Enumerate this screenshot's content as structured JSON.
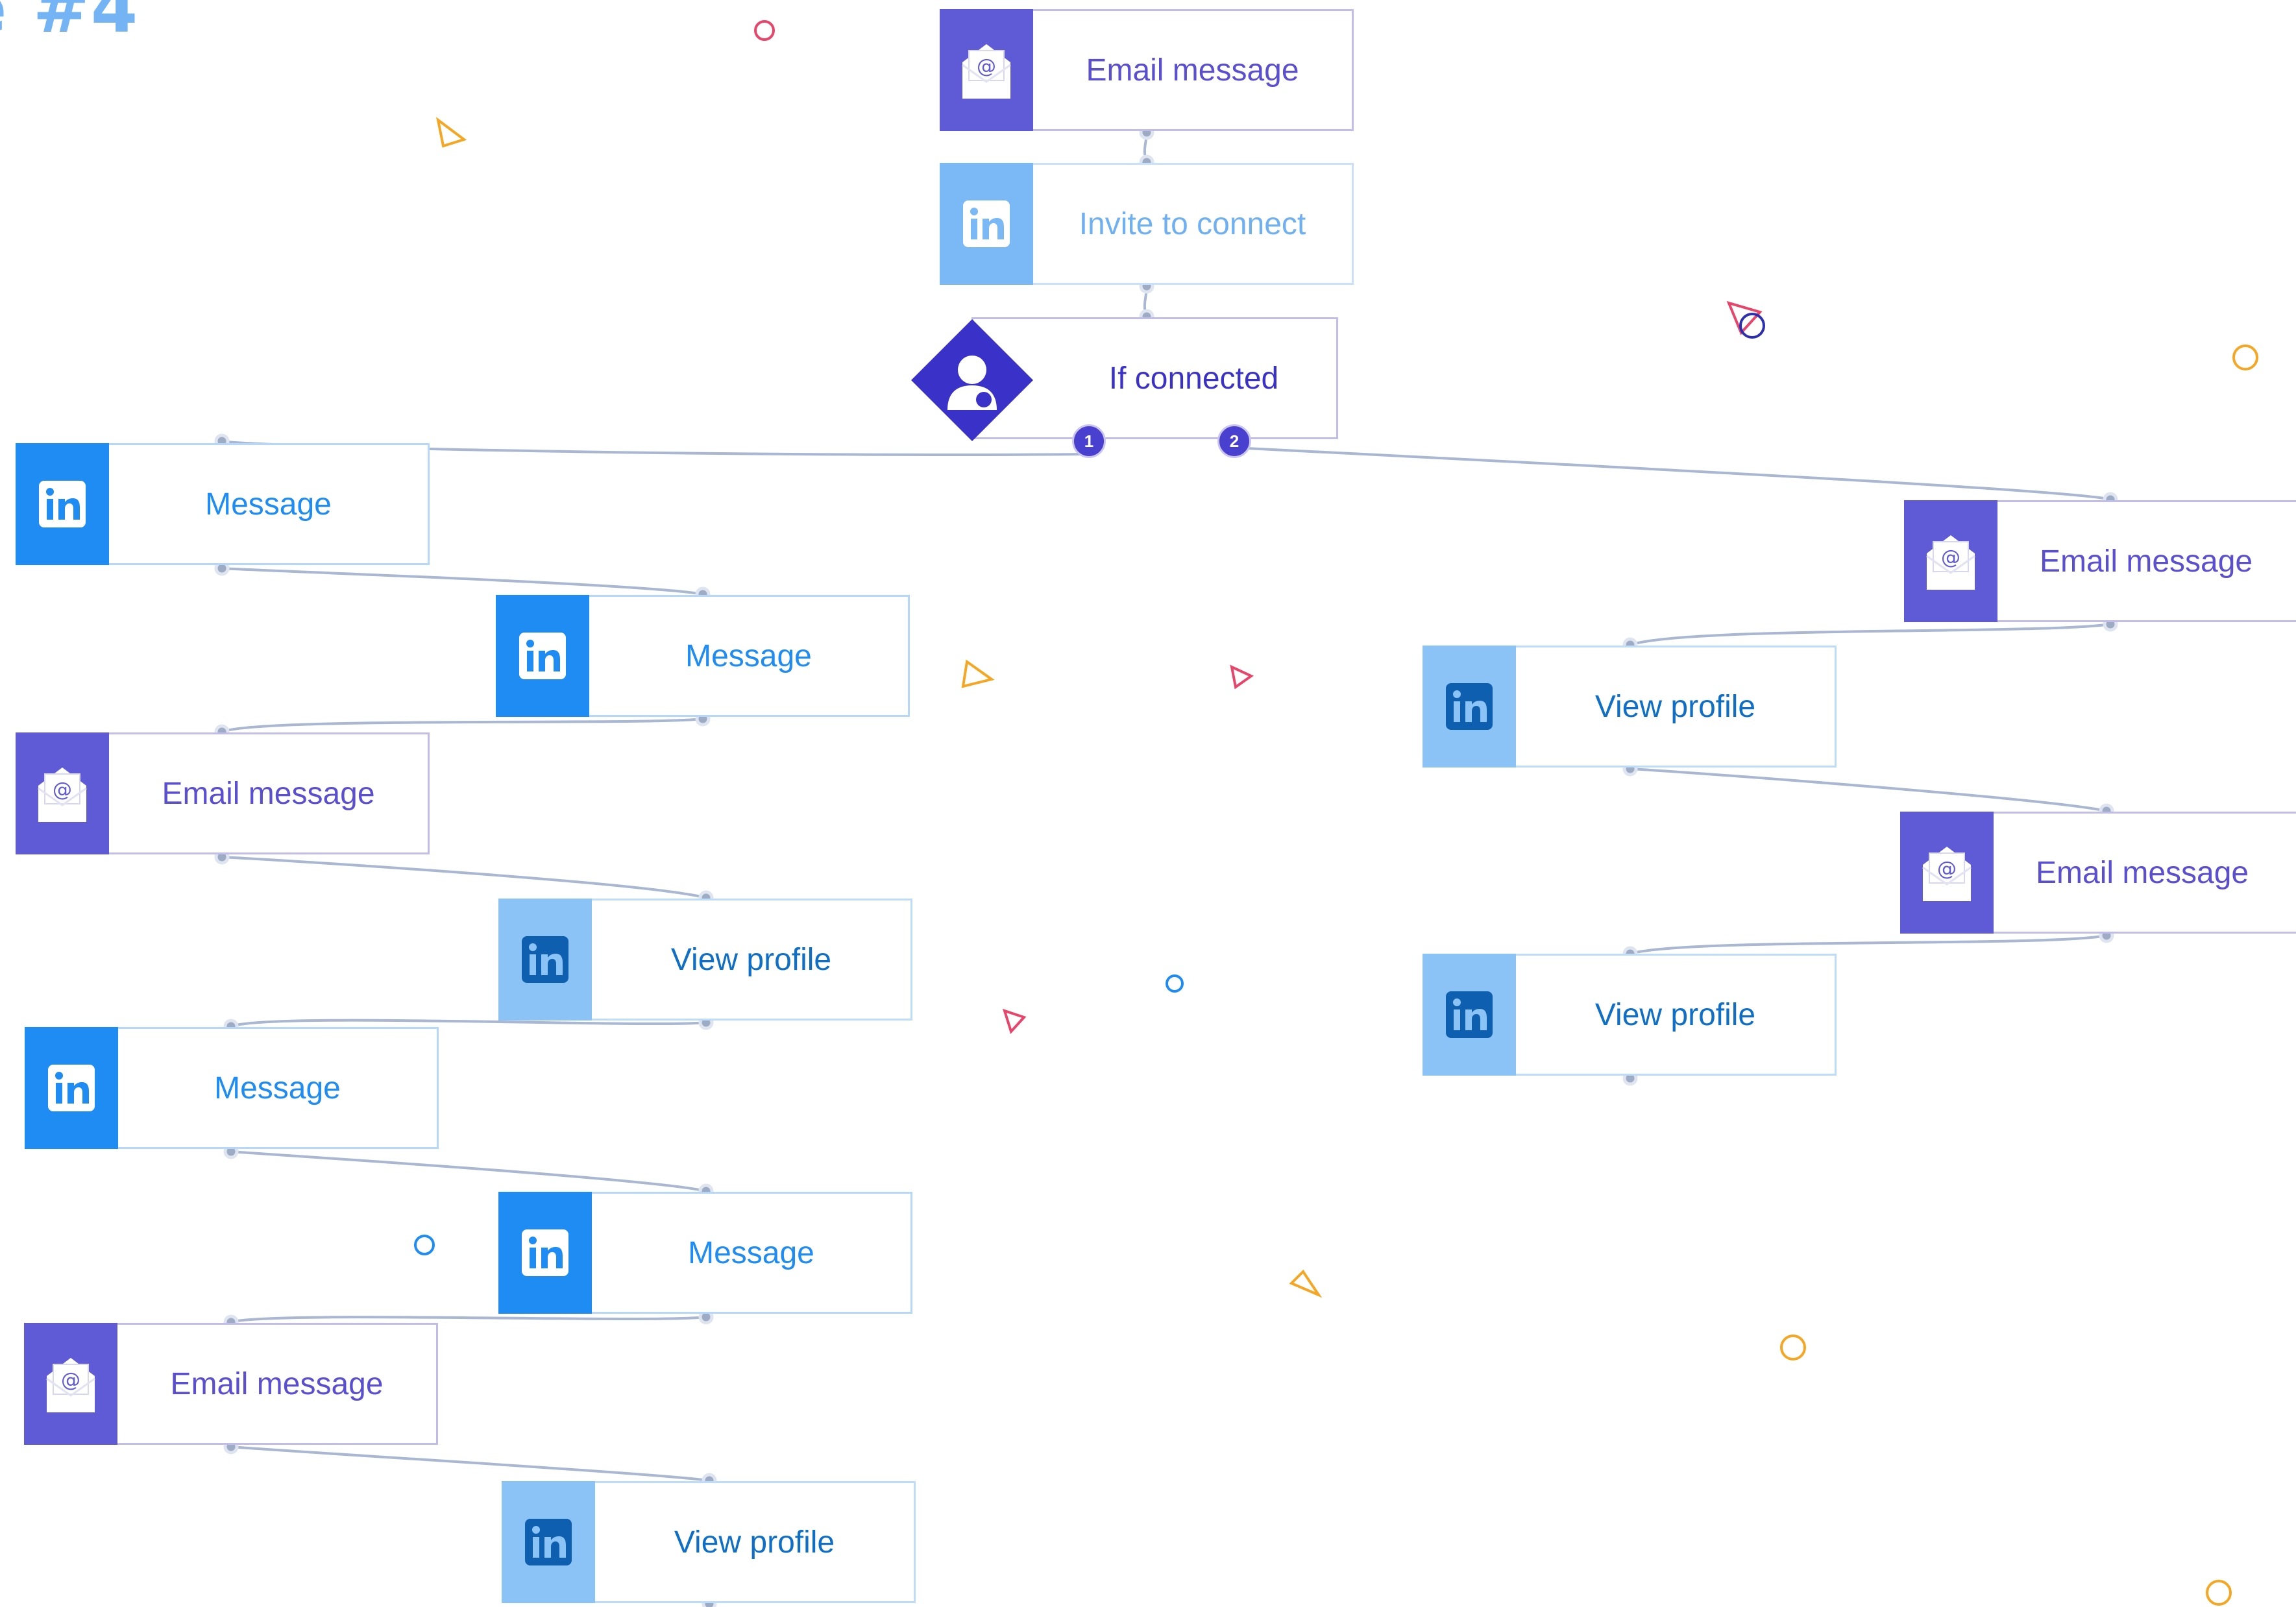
{
  "heading": "e #4",
  "colors": {
    "email_tile": "#5f5bd6",
    "linkedin_message_tile": "#1e8cf2",
    "linkedin_view_tile": "#8cc3f7",
    "linkedin_invite_tile": "#7ab8f6",
    "condition_diamond": "#3a31c9",
    "connector": "#a9b7d3"
  },
  "nodes": {
    "top_email": {
      "label": "Email message",
      "icon": "email-icon"
    },
    "invite": {
      "label": "Invite to connect",
      "icon": "linkedin-icon"
    },
    "condition": {
      "label": "If connected",
      "icon": "connected-user-icon",
      "branches": [
        "1",
        "2"
      ]
    },
    "l1": {
      "label": "Message",
      "icon": "linkedin-icon"
    },
    "l2": {
      "label": "Message",
      "icon": "linkedin-icon"
    },
    "l3": {
      "label": "Email message",
      "icon": "email-icon"
    },
    "l4": {
      "label": "View profile",
      "icon": "linkedin-icon"
    },
    "l5": {
      "label": "Message",
      "icon": "linkedin-icon"
    },
    "l6": {
      "label": "Message",
      "icon": "linkedin-icon"
    },
    "l7": {
      "label": "Email message",
      "icon": "email-icon"
    },
    "l8": {
      "label": "View profile",
      "icon": "linkedin-icon"
    },
    "r1": {
      "label": "Email message",
      "icon": "email-icon"
    },
    "r2": {
      "label": "View profile",
      "icon": "linkedin-icon"
    },
    "r3": {
      "label": "Email message",
      "icon": "email-icon"
    },
    "r4": {
      "label": "View profile",
      "icon": "linkedin-icon"
    }
  }
}
